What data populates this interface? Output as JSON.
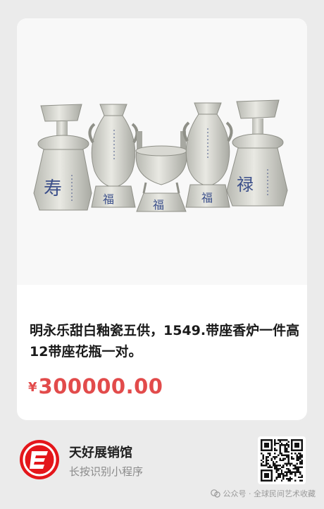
{
  "product": {
    "image_alt": "white glazed porcelain five-piece altar set",
    "jar_labels": [
      "寿",
      "福",
      "禄"
    ],
    "title": "明永乐甜白釉瓷五供，1549.带座香炉一件高12带座花瓶一对。",
    "price_symbol": "¥",
    "price": "300000.00"
  },
  "shop": {
    "name": "天好展销馆",
    "hint": "长按识别小程序",
    "logo_icon": "shop-logo-red-e",
    "qr_icon": "qr-code"
  },
  "watermark": {
    "text": "公众号 · 全球民间艺术收藏",
    "icon": "wechat-channel-icon"
  },
  "colors": {
    "price": "#e24b4b",
    "logo_red": "#e4161b",
    "background": "#ebebeb"
  }
}
